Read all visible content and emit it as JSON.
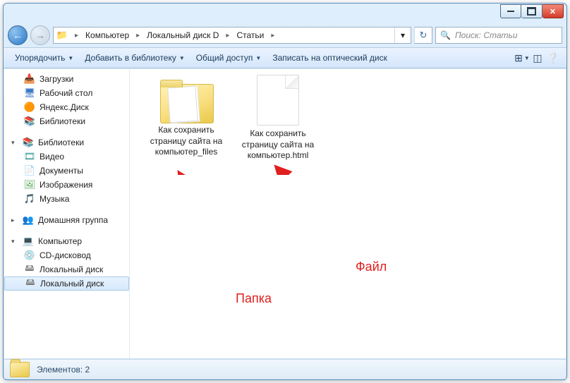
{
  "window": {
    "breadcrumb": [
      "Компьютер",
      "Локальный диск D",
      "Статьи"
    ],
    "search_placeholder": "Поиск: Статьи"
  },
  "toolbar": {
    "organize": "Упорядочить",
    "add_to_library": "Добавить в библиотеку",
    "share": "Общий доступ",
    "burn": "Записать на оптический диск"
  },
  "nav": {
    "downloads": "Загрузки",
    "desktop": "Рабочий стол",
    "yandex_disk": "Яндекс.Диск",
    "libraries_top": "Библиотеки",
    "libraries": "Библиотеки",
    "video": "Видео",
    "documents": "Документы",
    "pictures": "Изображения",
    "music": "Музыка",
    "homegroup": "Домашняя группа",
    "computer": "Компьютер",
    "cd_drive": "CD-дисковод",
    "local_disk1": "Локальный диск",
    "local_disk2": "Локальный диск"
  },
  "items": {
    "folder_name": "Как сохранить страницу сайта на компьютер_files",
    "file_name": "Как сохранить страницу сайта на компьютер.html"
  },
  "annotations": {
    "folder_label": "Папка",
    "file_label": "Файл"
  },
  "status": {
    "text": "Элементов: 2"
  }
}
